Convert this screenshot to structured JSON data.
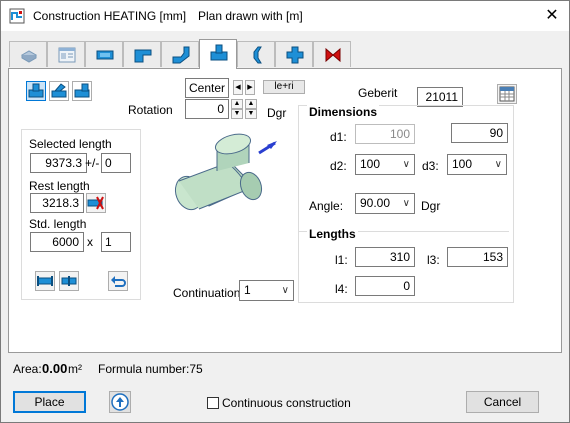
{
  "window": {
    "title": "Construction HEATING [mm]",
    "plan_info": "Plan drawn with  [m]",
    "close_glyph": "✕"
  },
  "tabs": [
    {
      "icon": "pipe-3d-icon",
      "active": false
    },
    {
      "icon": "form-view-icon",
      "active": false
    },
    {
      "icon": "straight-pipe-icon",
      "active": false
    },
    {
      "icon": "bend-pipe-icon",
      "active": false
    },
    {
      "icon": "offset-pipe-icon",
      "active": false
    },
    {
      "icon": "tee-fitting-icon",
      "active": true
    },
    {
      "icon": "reducer-icon",
      "active": false
    },
    {
      "icon": "cross-fitting-icon",
      "active": false
    },
    {
      "icon": "valve-icon",
      "active": false
    }
  ],
  "toolbar": {
    "fitting_types": [
      "tee-straight-icon",
      "tee-angled-icon",
      "tee-offset-icon"
    ]
  },
  "rotation": {
    "label": "Rotation",
    "value": "0",
    "unit": "Dgr"
  },
  "position": {
    "value": "Center",
    "le_ri_label": "le+ri"
  },
  "manufacturer": {
    "label": "Geberit",
    "code": "21011"
  },
  "length_group": {
    "selected_label": "Selected length",
    "selected_value": "9373.3",
    "tolerance_symbol": "+/-",
    "tolerance_value": "0",
    "rest_label": "Rest length",
    "rest_value": "3218.3",
    "std_label": "Std. length",
    "std_value": "6000",
    "multiply_symbol": "x",
    "std_count": "1"
  },
  "continuation": {
    "label": "Continuation",
    "value": "1"
  },
  "dimensions": {
    "title": "Dimensions",
    "d1_label": "d1:",
    "d1_value": "100",
    "d1_right_value": "90",
    "d2_label": "d2:",
    "d2_value": "100",
    "d3_label": "d3:",
    "d3_value": "100",
    "angle_label": "Angle:",
    "angle_value": "90.00",
    "angle_unit": "Dgr"
  },
  "lengths": {
    "title": "Lengths",
    "l1_label": "l1:",
    "l1_value": "310",
    "l3_label": "l3:",
    "l3_value": "153",
    "l4_label": "l4:",
    "l4_value": "0"
  },
  "status": {
    "area_label": "Area:",
    "area_value": "0.00",
    "area_unit": "m²",
    "formula_label": "Formula number:75"
  },
  "footer": {
    "place_label": "Place",
    "continuous_label": "Continuous construction",
    "continuous_checked": false,
    "cancel_label": "Cancel"
  },
  "colors": {
    "accent": "#0078d7",
    "pipe_blue": "#1e8fd6",
    "valve_red": "#d01010",
    "fitting_body": "#c8e2c8"
  }
}
